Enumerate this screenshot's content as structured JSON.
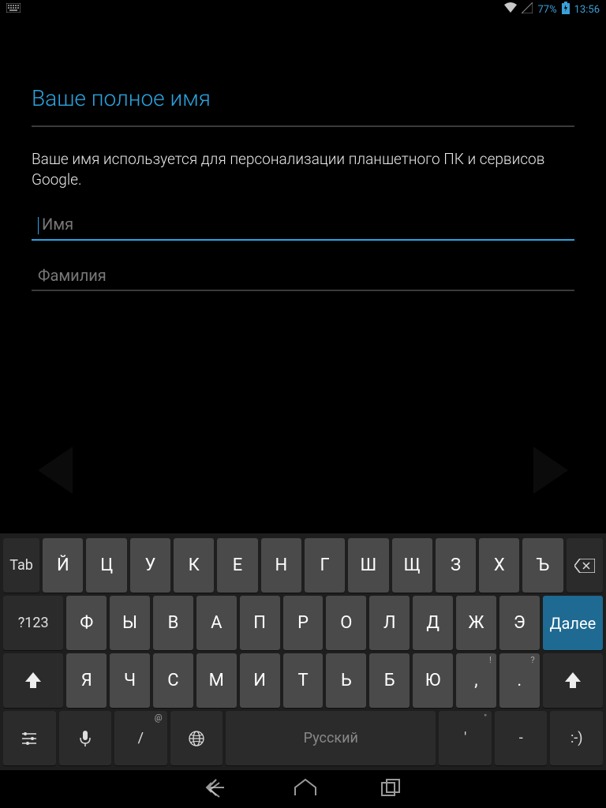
{
  "status": {
    "battery_pct": "77%",
    "time": "13:56"
  },
  "page": {
    "title": "Ваше полное имя",
    "subtitle": "Ваше имя используется для персонализации планшетного ПК и сервисов Google.",
    "first_name_placeholder": "Имя",
    "last_name_placeholder": "Фамилия"
  },
  "keyboard": {
    "tab": "Tab",
    "sym": "?123",
    "next": "Далее",
    "space": "Русский",
    "row1": [
      "Й",
      "Ц",
      "У",
      "К",
      "Е",
      "Н",
      "Г",
      "Ш",
      "Щ",
      "З",
      "Х",
      "Ъ"
    ],
    "row2": [
      "Ф",
      "Ы",
      "В",
      "А",
      "П",
      "Р",
      "О",
      "Л",
      "Д",
      "Ж",
      "Э"
    ],
    "row3": [
      "Я",
      "Ч",
      "С",
      "М",
      "И",
      "Т",
      "Ь",
      "Б",
      "Ю",
      ",",
      "."
    ],
    "row4_slash": "/",
    "row4_quote": "'",
    "row4_dash": "-",
    "row4_smile": ":-)",
    "sub_at": "@",
    "sub_excl": "!",
    "sub_q": "?",
    "sub_dq": "\""
  }
}
